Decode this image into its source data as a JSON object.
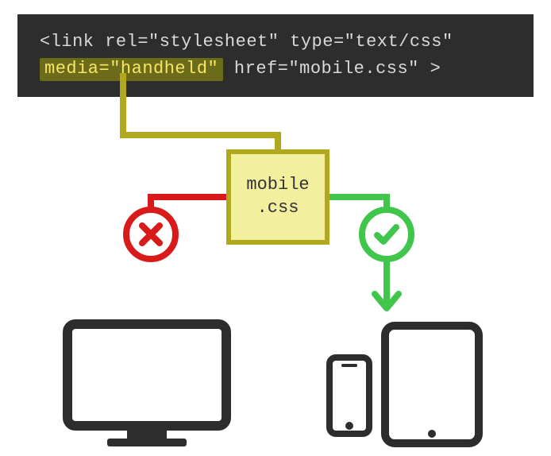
{
  "code": {
    "line1_part1": "<link rel=\"stylesheet\" type=\"text/css\"",
    "highlighted": "media=\"handheld\"",
    "line2_part2": " href=\"mobile.css\" >"
  },
  "file_label_line1": "mobile",
  "file_label_line2": ".css",
  "icons": {
    "cross": "cross-icon",
    "check": "check-icon",
    "monitor": "desktop-monitor-icon",
    "phone": "smartphone-icon",
    "tablet": "tablet-icon"
  },
  "colors": {
    "code_bg": "#2d2d2d",
    "highlight_bg": "#6b6b1a",
    "highlight_fg": "#f5e663",
    "file_fill": "#f2ef9e",
    "file_border": "#b1a81f",
    "red": "#d91a1a",
    "green": "#3fc64b",
    "device": "#2d2d2d"
  }
}
